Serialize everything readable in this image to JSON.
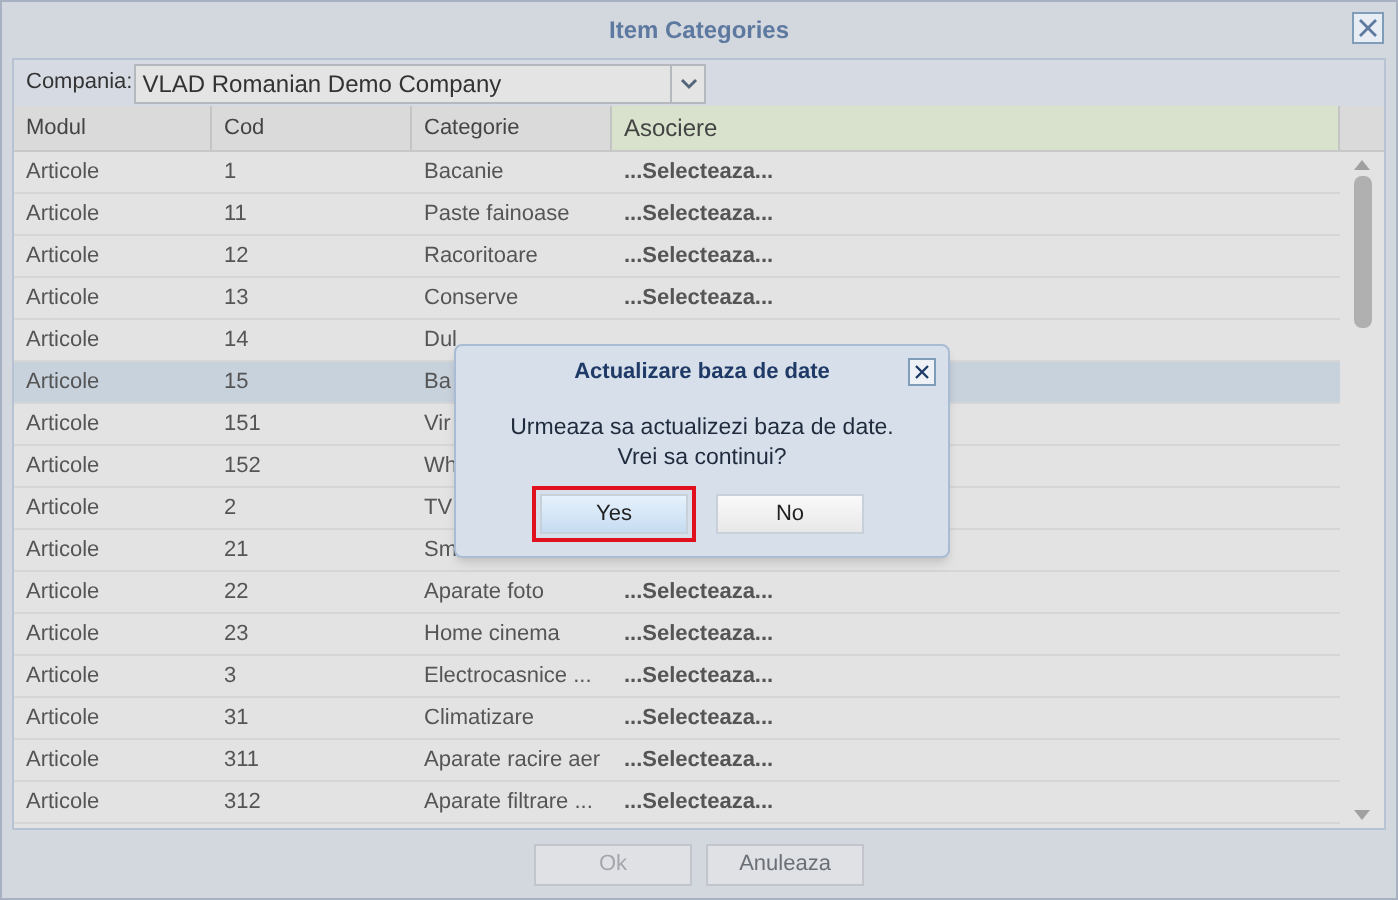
{
  "window": {
    "title": "Item Categories"
  },
  "company": {
    "label": "Compania:",
    "value": "VLAD Romanian Demo Company"
  },
  "table": {
    "columns": [
      "Modul",
      "Cod",
      "Categorie",
      "Asociere"
    ],
    "rows": [
      {
        "modul": "Articole",
        "cod": "1",
        "categorie": "Bacanie",
        "asociere": "...Selecteaza...",
        "selected": false
      },
      {
        "modul": "Articole",
        "cod": "11",
        "categorie": "Paste fainoase",
        "asociere": "...Selecteaza...",
        "selected": false
      },
      {
        "modul": "Articole",
        "cod": "12",
        "categorie": "Racoritoare",
        "asociere": "...Selecteaza...",
        "selected": false
      },
      {
        "modul": "Articole",
        "cod": "13",
        "categorie": "Conserve",
        "asociere": "...Selecteaza...",
        "selected": false
      },
      {
        "modul": "Articole",
        "cod": "14",
        "categorie": "Dul",
        "selected": false
      },
      {
        "modul": "Articole",
        "cod": "15",
        "categorie": "Ba",
        "selected": true
      },
      {
        "modul": "Articole",
        "cod": "151",
        "categorie": "Vir",
        "selected": false
      },
      {
        "modul": "Articole",
        "cod": "152",
        "categorie": "Wh",
        "selected": false
      },
      {
        "modul": "Articole",
        "cod": "2",
        "categorie": "TV",
        "selected": false
      },
      {
        "modul": "Articole",
        "cod": "21",
        "categorie": "Sm",
        "selected": false
      },
      {
        "modul": "Articole",
        "cod": "22",
        "categorie": "Aparate foto",
        "asociere": "...Selecteaza...",
        "selected": false
      },
      {
        "modul": "Articole",
        "cod": "23",
        "categorie": "Home cinema",
        "asociere": "...Selecteaza...",
        "selected": false
      },
      {
        "modul": "Articole",
        "cod": "3",
        "categorie": "Electrocasnice ...",
        "asociere": "...Selecteaza...",
        "selected": false
      },
      {
        "modul": "Articole",
        "cod": "31",
        "categorie": "Climatizare",
        "asociere": "...Selecteaza...",
        "selected": false
      },
      {
        "modul": "Articole",
        "cod": "311",
        "categorie": "Aparate racire aer",
        "asociere": "...Selecteaza...",
        "selected": false
      },
      {
        "modul": "Articole",
        "cod": "312",
        "categorie": "Aparate filtrare ...",
        "asociere": "...Selecteaza...",
        "selected": false
      }
    ]
  },
  "buttons": [
    {
      "label": "Ok",
      "disabled": true
    },
    {
      "label": "Anuleaza",
      "disabled": false
    }
  ],
  "dialog": {
    "title": "Actualizare baza de date",
    "message": [
      "Urmeaza sa actualizezi baza de date.",
      "Vrei sa continui?"
    ],
    "buttons": [
      {
        "label": "Yes",
        "focused": true
      },
      {
        "label": "No",
        "focused": false
      }
    ]
  }
}
